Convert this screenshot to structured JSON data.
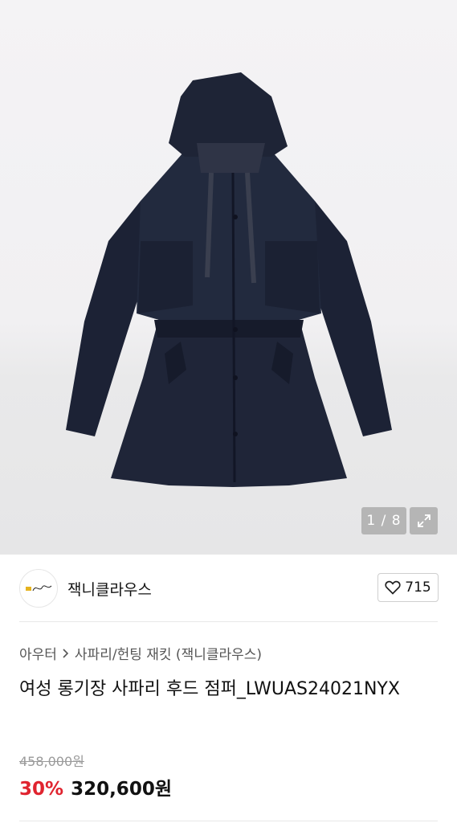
{
  "gallery": {
    "image_alt": "navy hooded safari jacket",
    "counter": "1 / 8",
    "expand_icon": "expand-icon"
  },
  "brand": {
    "name": "잭니클라우스",
    "logo_icon": "brand-logo",
    "like_icon": "heart-icon",
    "like_count": "715"
  },
  "breadcrumb": {
    "items": [
      "아우터",
      "사파리/헌팅 재킷 (잭니클라우스)"
    ],
    "separator_icon": "chevron-right-icon"
  },
  "product": {
    "title": "여성 롱기장 사파리 후드 점퍼_LWUAS24021NYX",
    "original_price": "458,000원",
    "discount_rate": "30%",
    "sale_price": "320,600원"
  },
  "colors": {
    "discount": "#e0242f",
    "jacket": "#1f2538"
  }
}
